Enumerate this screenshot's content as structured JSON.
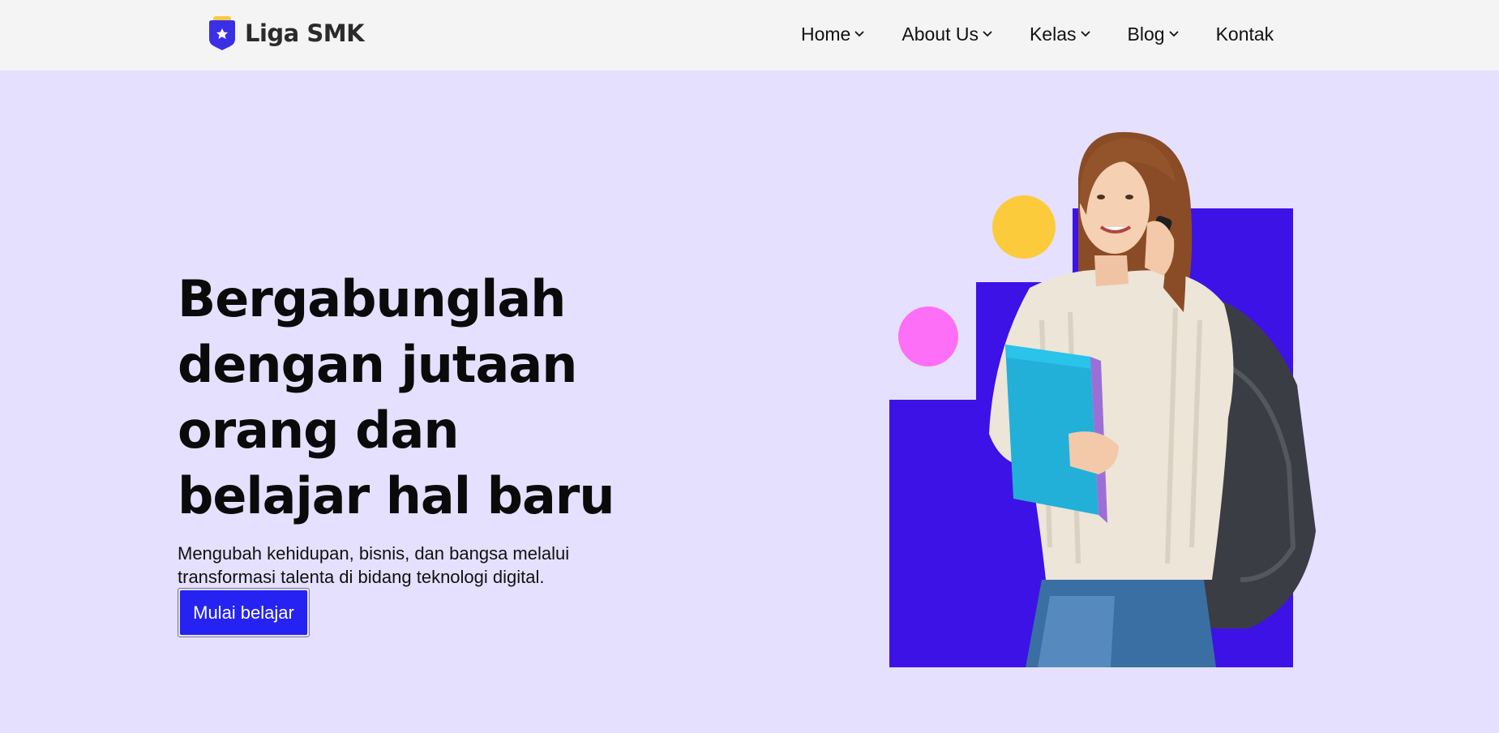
{
  "brand": {
    "name": "Liga SMK",
    "logo_icon": "shield-star-icon",
    "colors": {
      "shield": "#3b2fe6",
      "top": "#f8c943"
    }
  },
  "nav": {
    "items": [
      {
        "label": "Home",
        "has_dropdown": true
      },
      {
        "label": "About Us",
        "has_dropdown": true
      },
      {
        "label": "Kelas",
        "has_dropdown": true
      },
      {
        "label": "Blog",
        "has_dropdown": true
      },
      {
        "label": "Kontak",
        "has_dropdown": false
      }
    ]
  },
  "hero": {
    "title_lines": [
      "Bergabunglah",
      "dengan jutaan",
      "orang dan",
      "belajar hal baru"
    ],
    "subtitle_lines": [
      "Mengubah kehidupan, bisnis, dan bangsa melalui",
      "transformasi talenta di bidang teknologi digital."
    ],
    "cta_label": "Mulai belajar"
  },
  "colors": {
    "page_bg": "#e5e0fe",
    "navbar_bg": "#f4f4f4",
    "accent": "#2623f2",
    "block": "#3d12e6",
    "circle_yellow": "#fbcb3b",
    "circle_pink": "#fc6ff6"
  }
}
